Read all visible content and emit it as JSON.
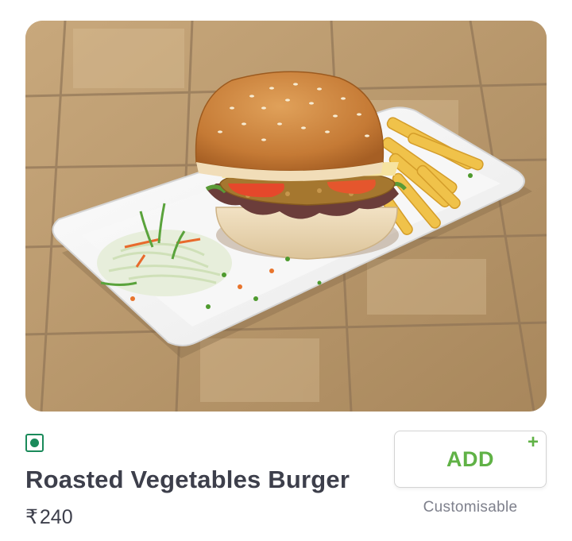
{
  "item": {
    "veg_indicator": "veg-icon",
    "name": "Roasted Vegetables Burger",
    "currency_symbol": "₹",
    "price": "240",
    "image_alt": "burger-photo"
  },
  "actions": {
    "add_label": "ADD",
    "add_plus": "+",
    "customisable_label": "Customisable"
  },
  "colors": {
    "veg_green": "#1a8a5a",
    "add_green": "#60b246",
    "text_dark": "#3d3f4b",
    "text_muted": "#7e808c"
  }
}
